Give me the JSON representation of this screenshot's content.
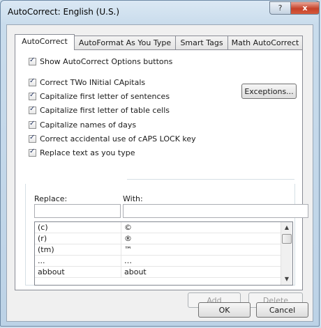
{
  "window": {
    "title": "AutoCorrect: English (U.S.)",
    "help_glyph": "?",
    "close_glyph": "x"
  },
  "tabs": [
    "AutoCorrect",
    "AutoFormat As You Type",
    "Smart Tags",
    "Math AutoCorrect"
  ],
  "options": {
    "show_buttons": "Show AutoCorrect Options buttons",
    "two_initial_caps": "Correct TWo INitial CApitals",
    "first_letter_sentences": "Capitalize first letter of sentences",
    "first_letter_table_cells": "Capitalize first letter of table cells",
    "names_of_days": "Capitalize names of days",
    "caps_lock": "Correct accidental use of cAPS LOCK key",
    "replace_text": "Replace text as you type"
  },
  "exceptions_label": "Exceptions...",
  "replace_label": "Replace:",
  "with_label": "With:",
  "replace_value": "",
  "with_value": "",
  "list": [
    {
      "replace": "(c)",
      "with": "©"
    },
    {
      "replace": "(r)",
      "with": "®"
    },
    {
      "replace": "(tm)",
      "with": "™"
    },
    {
      "replace": "...",
      "with": "…"
    },
    {
      "replace": "abbout",
      "with": "about"
    }
  ],
  "add_label": "Add",
  "delete_label": "Delete",
  "ok_label": "OK",
  "cancel_label": "Cancel"
}
